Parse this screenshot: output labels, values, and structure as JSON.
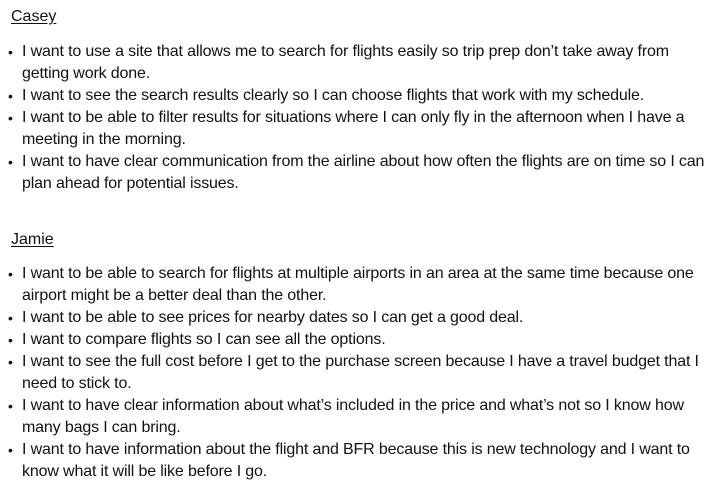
{
  "personas": [
    {
      "name": "Casey",
      "stories": [
        "I want to use a site that allows me to search for flights easily so trip prep don’t take away from getting work done.",
        "I want to see the search results clearly so I can choose flights that work with my schedule.",
        "I want to be able to filter results for situations where I can only fly in the afternoon when I have a meeting in the morning.",
        "I want to have clear communication from the airline about how often the flights are on time so I can plan ahead for potential issues."
      ]
    },
    {
      "name": "Jamie",
      "stories": [
        "I want to be able to search for flights at multiple airports in an area at the same time because one airport might be a better deal than the other.",
        "I want to be able to see prices for nearby dates so I can get a good deal.",
        "I want to compare flights so I can see all the options.",
        "I want to see the full cost before I get to the purchase screen because I have a travel budget that I need to stick to.",
        "I want to have clear information about what’s included in the price and what’s not so I know how many bags I can bring.",
        "I want to have information about the flight and BFR because this is new technology and I want to know what it will be like before I go."
      ]
    }
  ],
  "bullet_glyph": "•"
}
